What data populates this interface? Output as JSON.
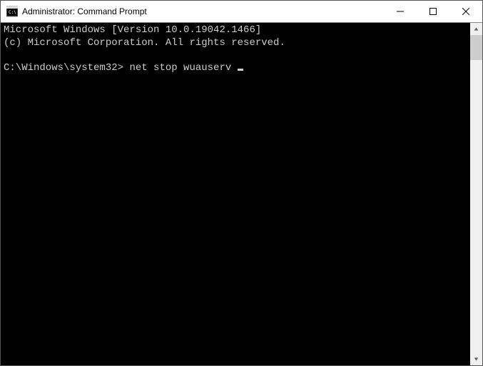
{
  "window": {
    "title": "Administrator: Command Prompt"
  },
  "terminal": {
    "line1": "Microsoft Windows [Version 10.0.19042.1466]",
    "line2": "(c) Microsoft Corporation. All rights reserved.",
    "blank": "",
    "prompt": "C:\\Windows\\system32>",
    "command": "net stop wuauserv"
  }
}
